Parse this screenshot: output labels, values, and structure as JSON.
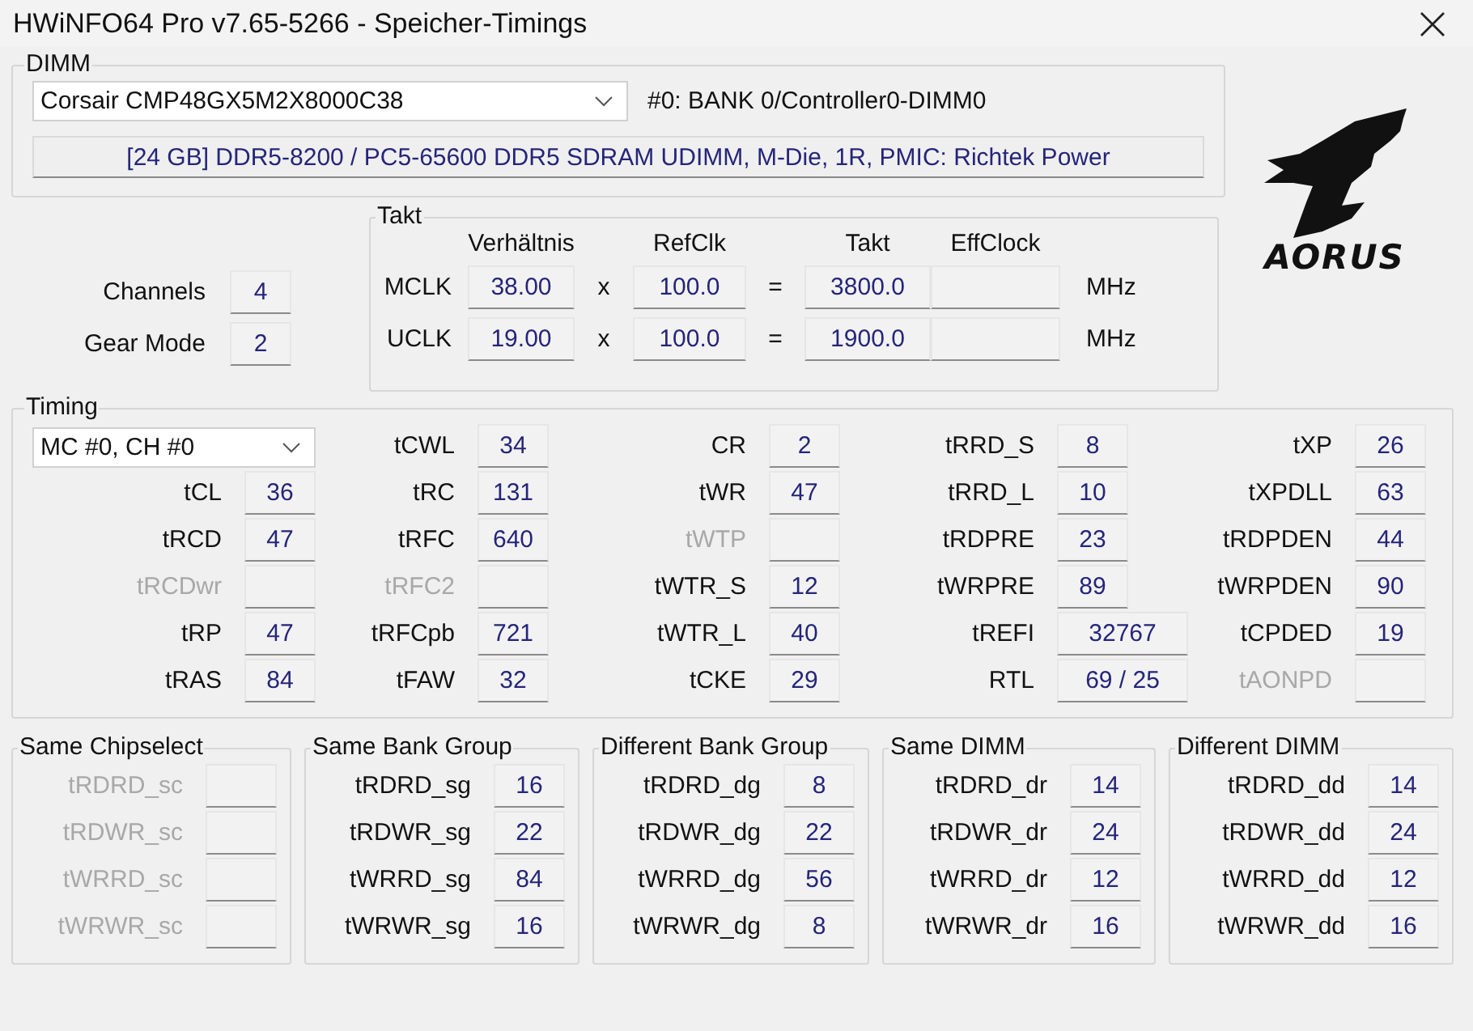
{
  "window": {
    "title": "HWiNFO64 Pro v7.65-5266 - Speicher-Timings"
  },
  "dimm": {
    "title": "DIMM",
    "module_select": {
      "value": "Corsair CMP48GX5M2X8000C38"
    },
    "slot": "#0: BANK 0/Controller0-DIMM0",
    "info": "[24 GB] DDR5-8200 / PC5-65600 DDR5 SDRAM UDIMM, M-Die, 1R, PMIC: Richtek Power"
  },
  "logo": {
    "text": "AORUS"
  },
  "general": [
    {
      "label": "Channels",
      "value": "4"
    },
    {
      "label": "Gear Mode",
      "value": "2"
    }
  ],
  "takt": {
    "title": "Takt",
    "columns": [
      "Verhältnis",
      "RefClk",
      "Takt",
      "EffClock"
    ],
    "rows": [
      {
        "label": "MCLK",
        "ratio": "38.00",
        "times": "x",
        "refclk": "100.0",
        "equals": "=",
        "clock": "3800.0",
        "unit": "MHz"
      },
      {
        "label": "UCLK",
        "ratio": "19.00",
        "times": "x",
        "refclk": "100.0",
        "equals": "=",
        "clock": "1900.0",
        "unit": "MHz"
      }
    ]
  },
  "timing": {
    "title": "Timing",
    "channel_select": {
      "value": "MC #0, CH #0"
    },
    "columns": [
      [
        {
          "label": "tCL",
          "value": "36",
          "disabled": false
        },
        {
          "label": "tRCD",
          "value": "47",
          "disabled": false
        },
        {
          "label": "tRCDwr",
          "disabled": true
        },
        {
          "label": "tRP",
          "value": "47",
          "disabled": false
        },
        {
          "label": "tRAS",
          "value": "84",
          "disabled": false
        }
      ],
      [
        {
          "label": "tCWL",
          "value": "34",
          "disabled": false
        },
        {
          "label": "tRC",
          "value": "131",
          "disabled": false
        },
        {
          "label": "tRFC",
          "value": "640",
          "disabled": false
        },
        {
          "label": "tRFC2",
          "disabled": true
        },
        {
          "label": "tRFCpb",
          "value": "721",
          "disabled": false
        },
        {
          "label": "tFAW",
          "value": "32",
          "disabled": false
        }
      ],
      [
        {
          "label": "CR",
          "value": "2",
          "disabled": false
        },
        {
          "label": "tWR",
          "value": "47",
          "disabled": false
        },
        {
          "label": "tWTP",
          "disabled": true
        },
        {
          "label": "tWTR_S",
          "value": "12",
          "disabled": false
        },
        {
          "label": "tWTR_L",
          "value": "40",
          "disabled": false
        },
        {
          "label": "tCKE",
          "value": "29",
          "disabled": false
        }
      ],
      [
        {
          "label": "tRRD_S",
          "value": "8",
          "disabled": false
        },
        {
          "label": "tRRD_L",
          "value": "10",
          "disabled": false
        },
        {
          "label": "tRDPRE",
          "value": "23",
          "disabled": false
        },
        {
          "label": "tWRPRE",
          "value": "89",
          "disabled": false
        },
        {
          "label": "tREFI",
          "value": "32767",
          "disabled": false
        },
        {
          "label": "RTL",
          "value": "69 / 25",
          "disabled": false
        }
      ],
      [
        {
          "label": "tXP",
          "value": "26",
          "disabled": false
        },
        {
          "label": "tXPDLL",
          "value": "63",
          "disabled": false
        },
        {
          "label": "tRDPDEN",
          "value": "44",
          "disabled": false
        },
        {
          "label": "tWRPDEN",
          "value": "90",
          "disabled": false
        },
        {
          "label": "tCPDED",
          "value": "19",
          "disabled": false
        },
        {
          "label": "tAONPD",
          "disabled": true
        }
      ]
    ]
  },
  "groups": [
    {
      "title": "Same Chipselect",
      "rows": [
        {
          "label": "tRDRD_sc",
          "disabled": true
        },
        {
          "label": "tRDWR_sc",
          "disabled": true
        },
        {
          "label": "tWRRD_sc",
          "disabled": true
        },
        {
          "label": "tWRWR_sc",
          "disabled": true
        }
      ]
    },
    {
      "title": "Same Bank Group",
      "rows": [
        {
          "label": "tRDRD_sg",
          "value": "16",
          "disabled": false
        },
        {
          "label": "tRDWR_sg",
          "value": "22",
          "disabled": false
        },
        {
          "label": "tWRRD_sg",
          "value": "84",
          "disabled": false
        },
        {
          "label": "tWRWR_sg",
          "value": "16",
          "disabled": false
        }
      ]
    },
    {
      "title": "Different Bank Group",
      "rows": [
        {
          "label": "tRDRD_dg",
          "value": "8",
          "disabled": false
        },
        {
          "label": "tRDWR_dg",
          "value": "22",
          "disabled": false
        },
        {
          "label": "tWRRD_dg",
          "value": "56",
          "disabled": false
        },
        {
          "label": "tWRWR_dg",
          "value": "8",
          "disabled": false
        }
      ]
    },
    {
      "title": "Same DIMM",
      "rows": [
        {
          "label": "tRDRD_dr",
          "value": "14",
          "disabled": false
        },
        {
          "label": "tRDWR_dr",
          "value": "24",
          "disabled": false
        },
        {
          "label": "tWRRD_dr",
          "value": "12",
          "disabled": false
        },
        {
          "label": "tWRWR_dr",
          "value": "16",
          "disabled": false
        }
      ]
    },
    {
      "title": "Different DIMM",
      "rows": [
        {
          "label": "tRDRD_dd",
          "value": "14",
          "disabled": false
        },
        {
          "label": "tRDWR_dd",
          "value": "24",
          "disabled": false
        },
        {
          "label": "tWRRD_dd",
          "value": "12",
          "disabled": false
        },
        {
          "label": "tWRWR_dd",
          "value": "16",
          "disabled": false
        }
      ]
    }
  ]
}
